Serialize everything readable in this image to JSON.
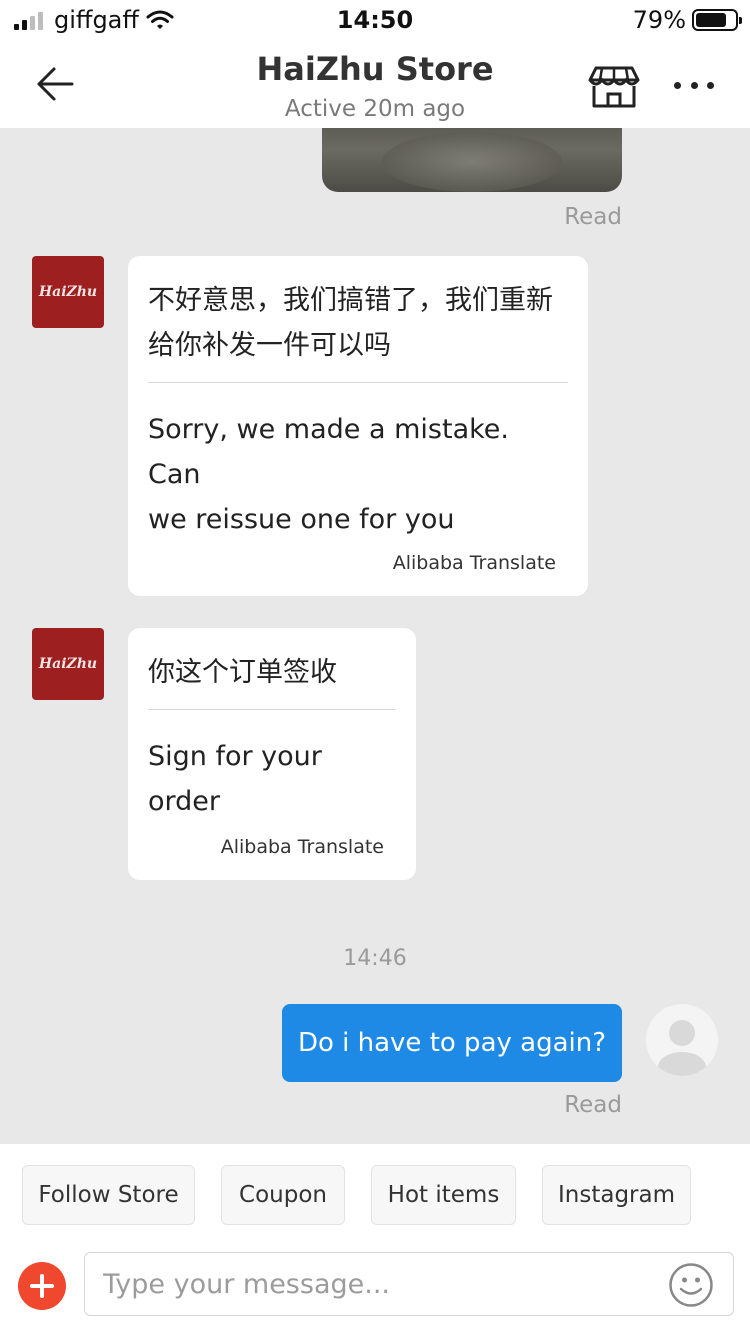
{
  "status_bar": {
    "carrier": "giffgaff",
    "time": "14:50",
    "battery_percent": "79%",
    "battery_level": 0.79,
    "signal_bars": 2
  },
  "header": {
    "title": "HaiZhu Store",
    "subtitle": "Active 20m ago"
  },
  "store_avatar": {
    "text": "HaiZhu",
    "color": "#9d1f1f"
  },
  "messages": {
    "photo_read": "Read",
    "store_msg_1": {
      "original_line1": "不好意思，我们搞错了，我们重新",
      "original_line2": "给你补发一件可以吗",
      "translation_line1": "Sorry, we made a mistake. Can",
      "translation_line2": "we reissue one for you",
      "credit": "Alibaba Translate"
    },
    "store_msg_2": {
      "original": "你这个订单签收",
      "translation": "Sign for your order",
      "credit": "Alibaba Translate"
    },
    "timestamp": "14:46",
    "my_msg": {
      "text": "Do i have to pay again?",
      "read": "Read"
    }
  },
  "quick_actions": [
    "Follow Store",
    "Coupon",
    "Hot items",
    "Instagram"
  ],
  "input": {
    "placeholder": "Type your message..."
  },
  "colors": {
    "accent_blue": "#1e8ae6",
    "add_button_red": "#f0472f",
    "chat_background": "#e8e8e8"
  }
}
